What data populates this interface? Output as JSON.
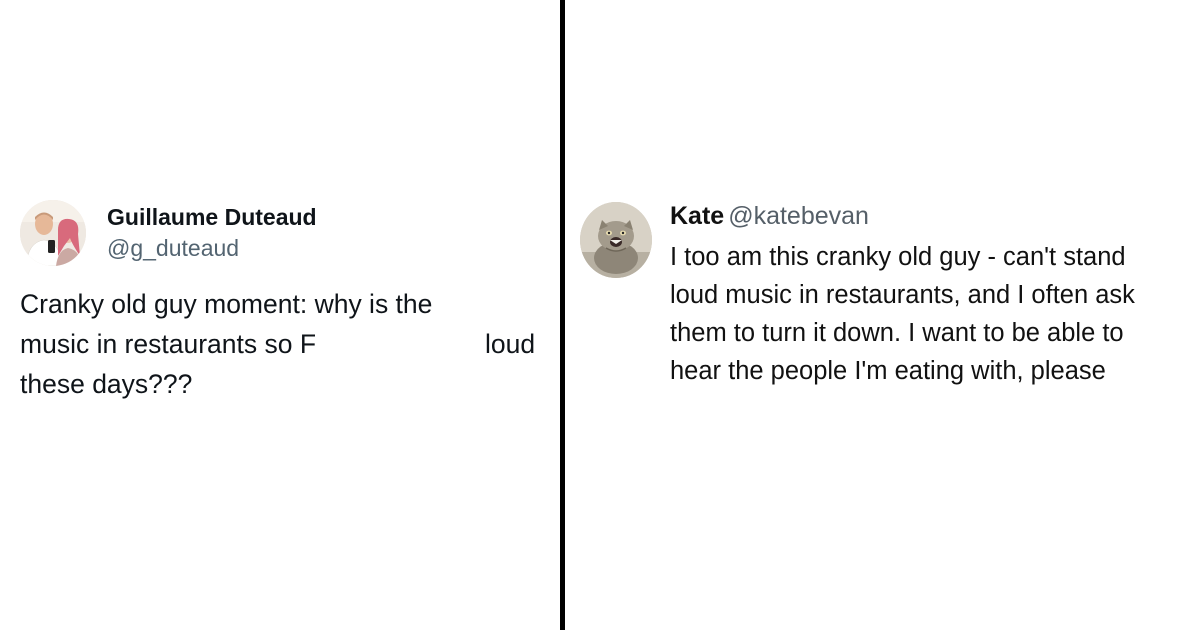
{
  "left_tweet": {
    "author_name": "Guillaume Duteaud",
    "author_handle": "@g_duteaud",
    "avatar_icon": "profile-photo-couple",
    "text_lines": [
      "Cranky old guy moment: why is the",
      "music in restaurants so F",
      "loud",
      "these days???"
    ]
  },
  "right_tweet": {
    "author_name": "Kate",
    "author_handle": "@katebevan",
    "avatar_icon": "profile-photo-wildcat",
    "text_lines": [
      "I too am this cranky old guy - can't stand",
      "loud music in restaurants, and I often ask",
      "them to turn it down. I want to be able to",
      "hear the people I'm eating with, please"
    ]
  },
  "colors": {
    "divider": "#000000",
    "name_text": "#0f1419",
    "handle_text": "#536471"
  }
}
